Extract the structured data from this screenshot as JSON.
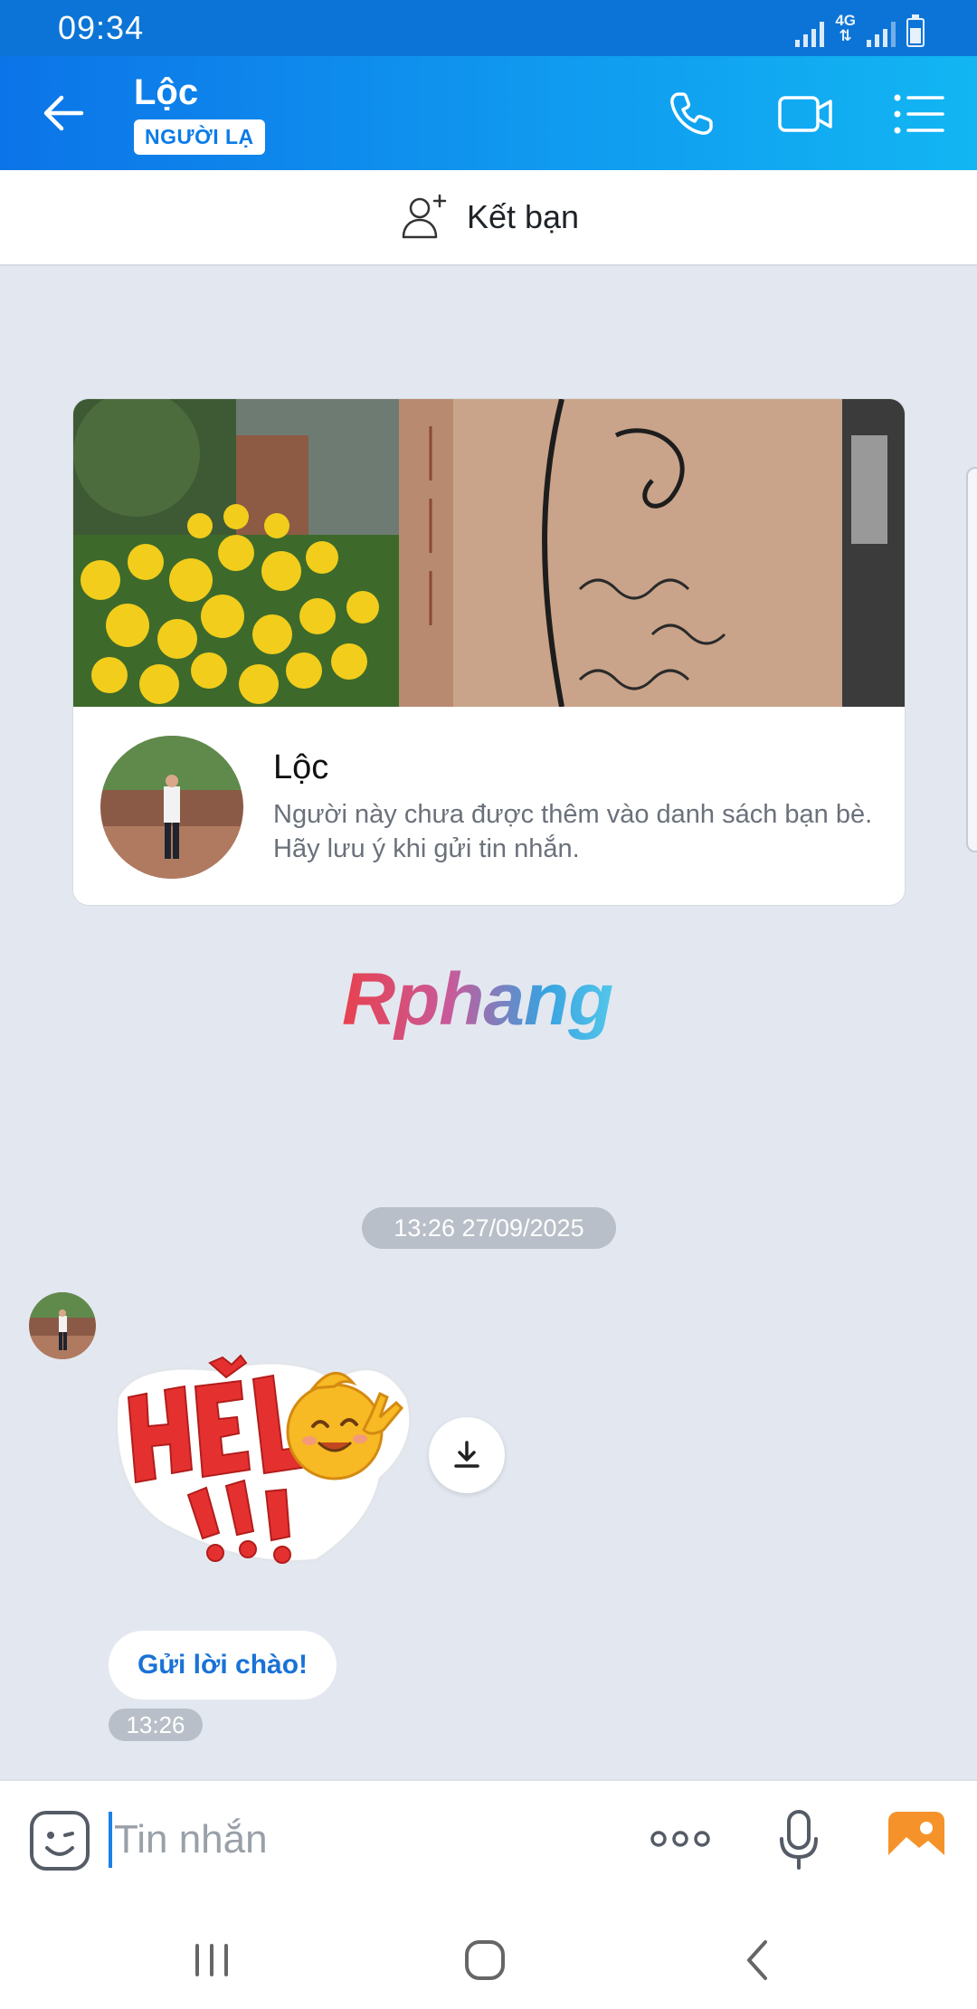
{
  "status_bar": {
    "time": "09:34",
    "network": "4G"
  },
  "header": {
    "contact_name": "Lộc",
    "badge": "NGƯỜI LẠ"
  },
  "add_friend": {
    "label": "Kết bạn"
  },
  "profile_card": {
    "name": "Lộc",
    "description": "Người này chưa được thêm vào danh sách bạn bè. Hãy lưu ý khi gửi tin nhắn."
  },
  "watermark": {
    "text": "Rphang"
  },
  "chat": {
    "date_separator": "13:26 27/09/2025",
    "greet_button": "Gửi lời chào!",
    "message_time": "13:26"
  },
  "input_bar": {
    "placeholder": "Tin nhắn"
  },
  "colors": {
    "header_start": "#0c74e8",
    "header_end": "#12b6f2",
    "accent": "#1a72d6",
    "chat_background": "#e3e8f0"
  },
  "icons": {
    "back": "arrow-left-icon",
    "call": "phone-icon",
    "video": "video-camera-icon",
    "menu": "list-menu-icon",
    "add_friend": "add-user-icon",
    "download": "download-icon",
    "emoji": "emoji-icon",
    "more": "more-dots-icon",
    "mic": "microphone-icon",
    "photo": "photo-gallery-icon"
  }
}
